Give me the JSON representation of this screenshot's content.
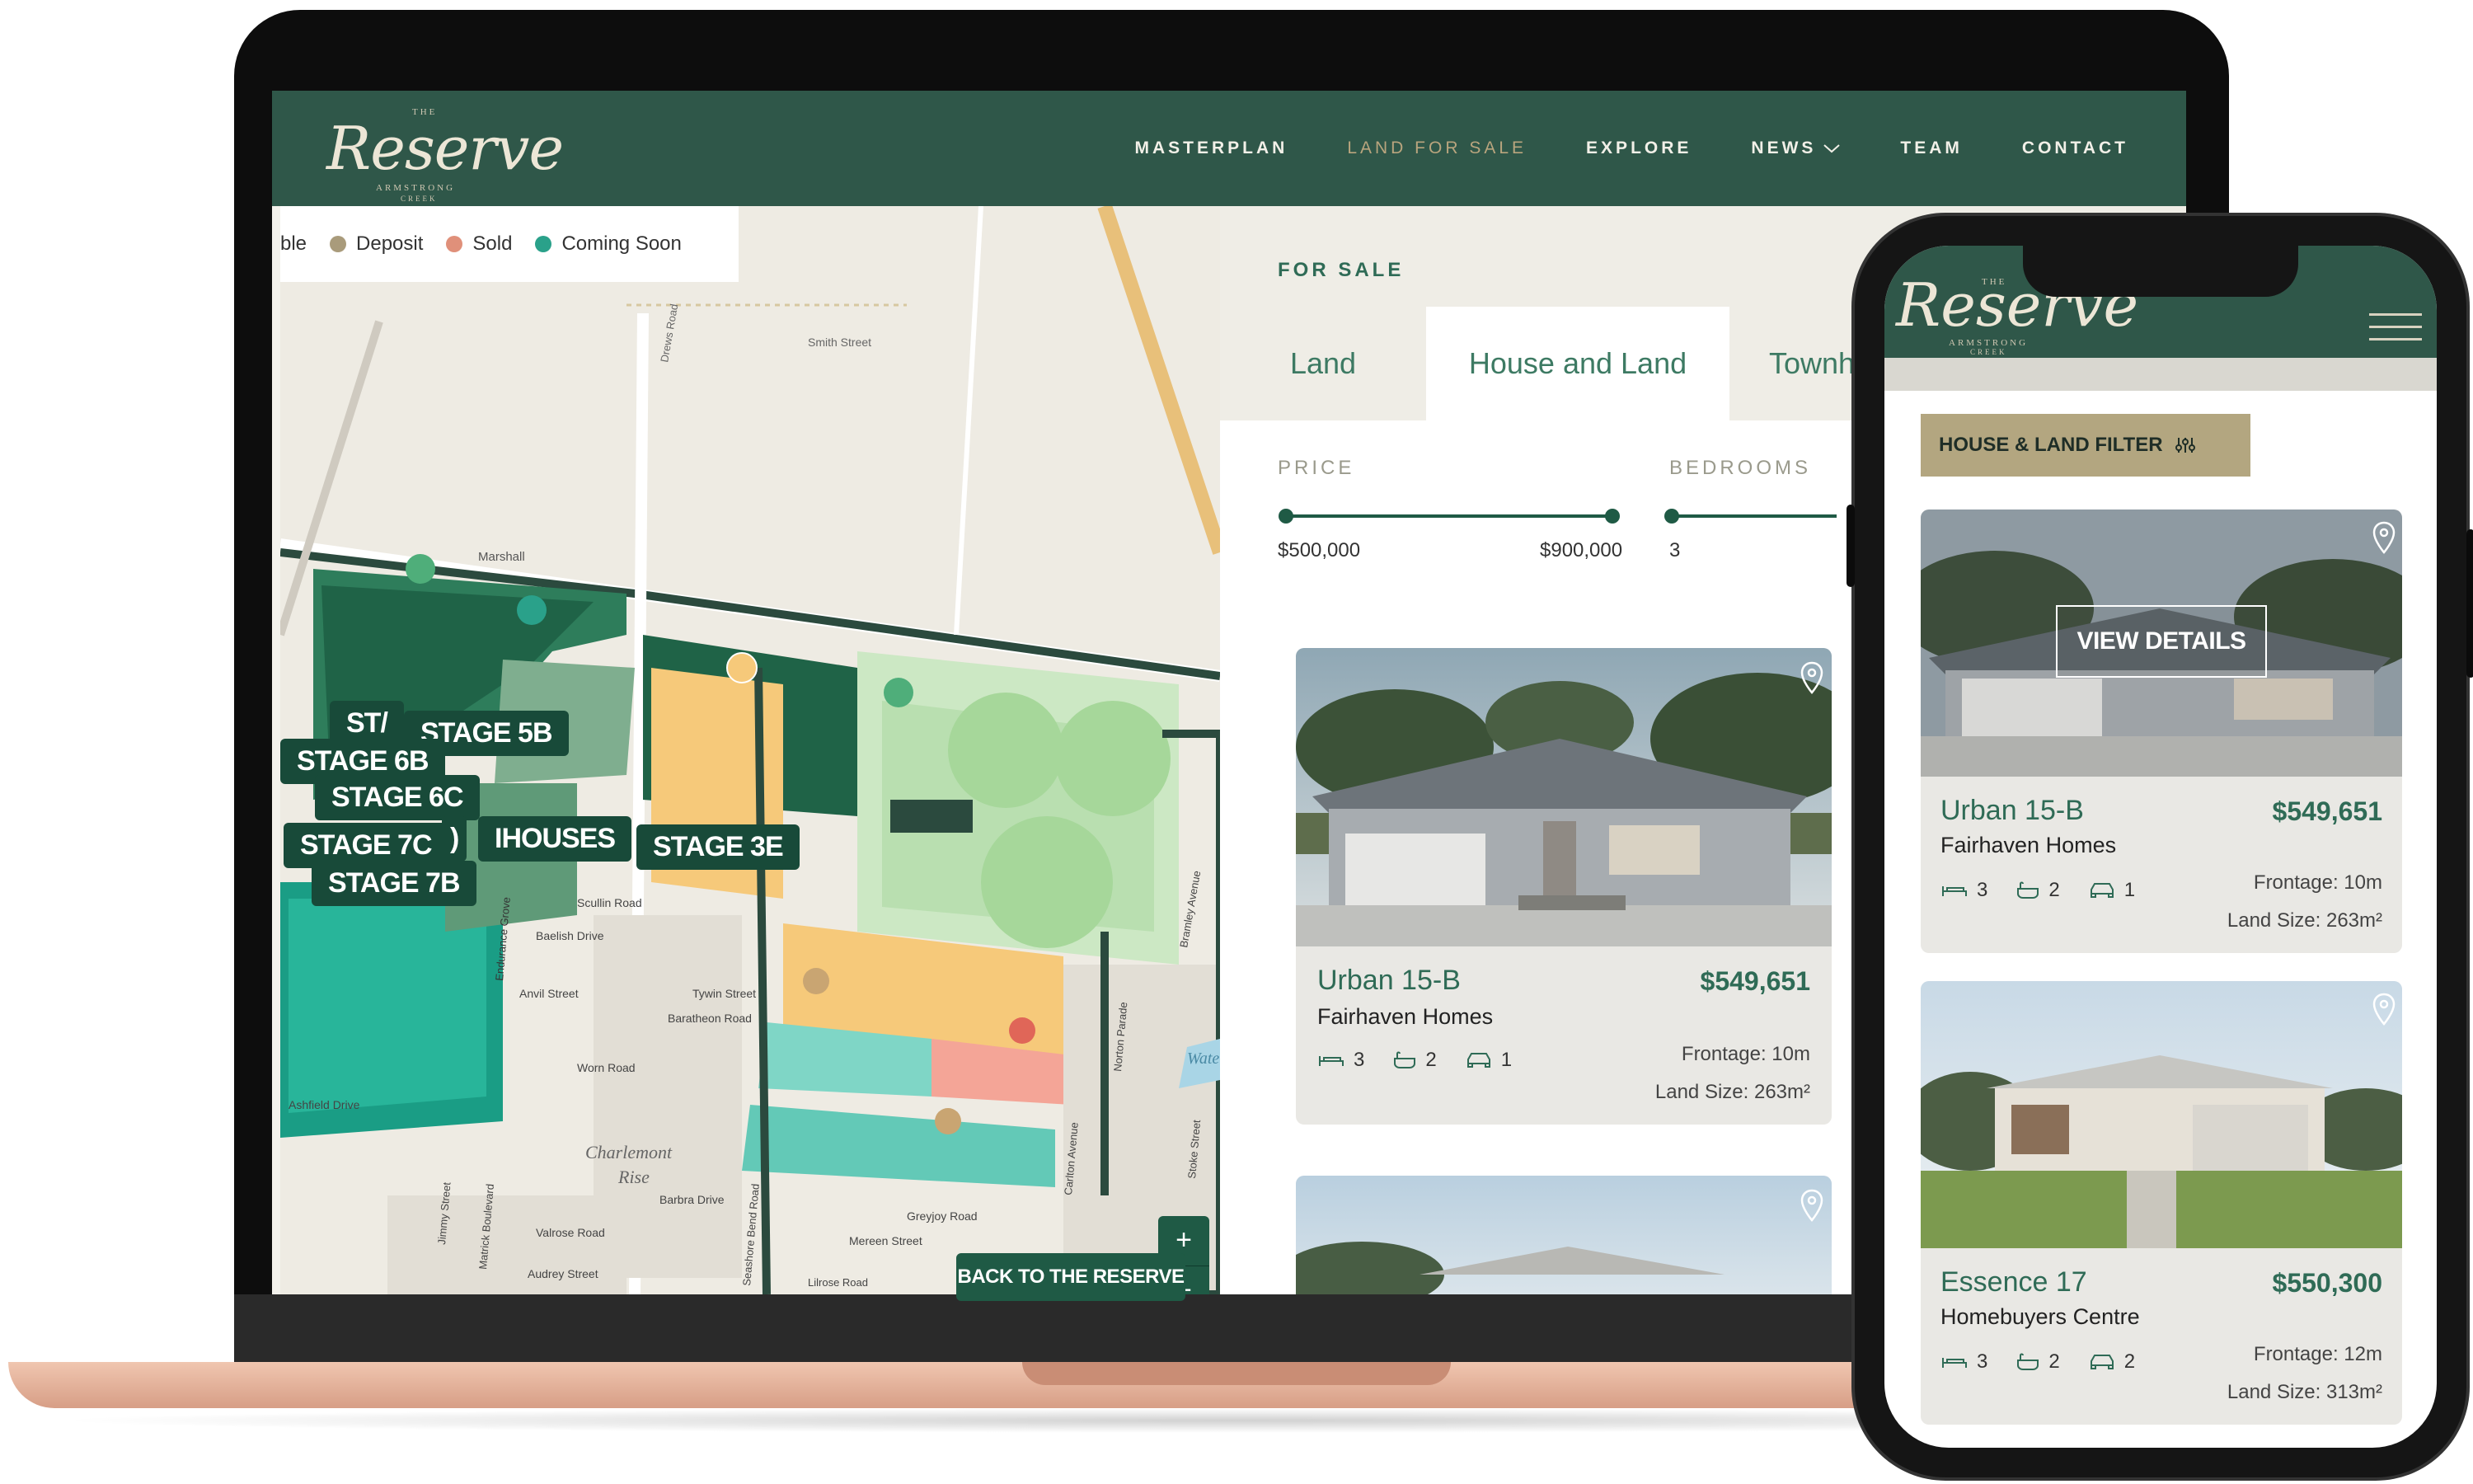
{
  "site": {
    "logo_small": "THE",
    "logo_main": "Reserve",
    "logo_sub1": "ARMSTRONG",
    "logo_sub2": "CREEK"
  },
  "nav": {
    "items": [
      {
        "label": "MASTERPLAN"
      },
      {
        "label": "LAND FOR SALE",
        "active": true
      },
      {
        "label": "EXPLORE"
      },
      {
        "label": "NEWS"
      },
      {
        "label": "TEAM"
      },
      {
        "label": "CONTACT"
      }
    ]
  },
  "map": {
    "legend": [
      {
        "label": "ble",
        "color": "#ffffff"
      },
      {
        "label": "Deposit",
        "color": "#a99b7b"
      },
      {
        "label": "Sold",
        "color": "#e0907a"
      },
      {
        "label": "Coming Soon",
        "color": "#2aa18a"
      }
    ],
    "stages": [
      "ST/",
      "STAGE 5B",
      "STAGE 6B",
      "STAGE 6C",
      "STAGE 7C",
      ")",
      "IHOUSES",
      "STAGE 3E",
      "STAGE 7B"
    ],
    "streets": [
      "Smith Street",
      "Drews Road",
      "Marshall",
      "Scullin Road",
      "Baelish Drive",
      "Anvil Street",
      "Tywin Street",
      "Baratheon Road",
      "Worn Road",
      "Ashfield Drive",
      "Charlemont",
      "Rise",
      "Barbra Drive",
      "Valrose Road",
      "Audrey Street",
      "Greyjoy Road",
      "Mereen Street",
      "Carlton Avenue",
      "Norton Parade",
      "Bramley Avenue",
      "Stoke Street",
      "Endurance Grove",
      "Matrick Boulevard",
      "Jimmy Street",
      "Seashore Bend Road",
      "Lilrose Road",
      "Wate"
    ],
    "zoom_in": "+",
    "zoom_out": "−",
    "back_label": "BACK TO THE RESERVE"
  },
  "panel": {
    "heading": "FOR SALE",
    "tabs": [
      {
        "label": "Land"
      },
      {
        "label": "House and Land",
        "active": true
      },
      {
        "label": "Townh"
      }
    ],
    "price_label": "PRICE",
    "price_min": "$500,000",
    "price_max": "$900,000",
    "bedrooms_label": "BEDROOMS",
    "bedrooms_value": "3",
    "cards": [
      {
        "title": "Urban 15-B",
        "price": "$549,651",
        "builder": "Fairhaven Homes",
        "beds": "3",
        "baths": "2",
        "cars": "1",
        "frontage": "Frontage: 10m",
        "land_size": "Land Size: 263m²"
      }
    ]
  },
  "phone": {
    "logo_small": "THE",
    "logo_main": "Reserve",
    "logo_sub1": "ARMSTRONG",
    "logo_sub2": "CREEK",
    "filter_label": "HOUSE & LAND FILTER",
    "view_details": "VIEW DETAILS",
    "cards": [
      {
        "title": "Urban 15-B",
        "price": "$549,651",
        "builder": "Fairhaven Homes",
        "beds": "3",
        "baths": "2",
        "cars": "1",
        "frontage": "Frontage: 10m",
        "land_size": "Land Size: 263m²"
      },
      {
        "title": "Essence 17",
        "price": "$550,300",
        "builder": "Homebuyers Centre",
        "beds": "3",
        "baths": "2",
        "cars": "2",
        "frontage": "Frontage: 12m",
        "land_size": "Land Size: 313m²"
      }
    ]
  },
  "colors": {
    "brand_green": "#2f5749",
    "accent_gold": "#b9a57e",
    "button_green": "#1f5a45",
    "text_green": "#2f6b56"
  }
}
